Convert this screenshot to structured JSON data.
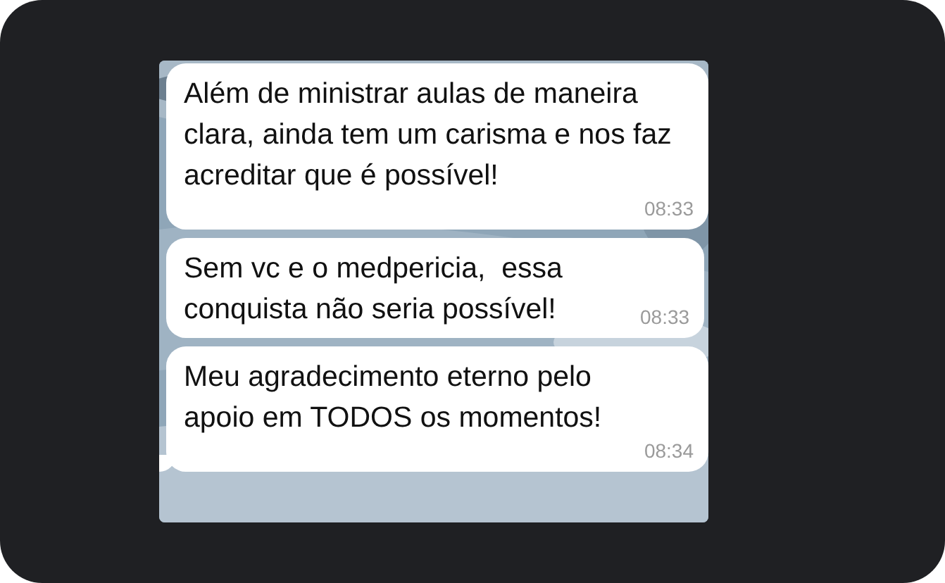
{
  "messages": [
    {
      "text": "Além de ministrar aulas de maneira clara, ainda tem um carisma e nos faz acreditar que é possível!",
      "time": "08:33",
      "tail": false
    },
    {
      "text": "Sem vc e o medpericia,  essa conquista não seria possível!",
      "time": "08:33",
      "tail": false
    },
    {
      "text": "Meu agradecimento eterno pelo apoio em TODOS os momentos!",
      "time": "08:34",
      "tail": true
    }
  ]
}
